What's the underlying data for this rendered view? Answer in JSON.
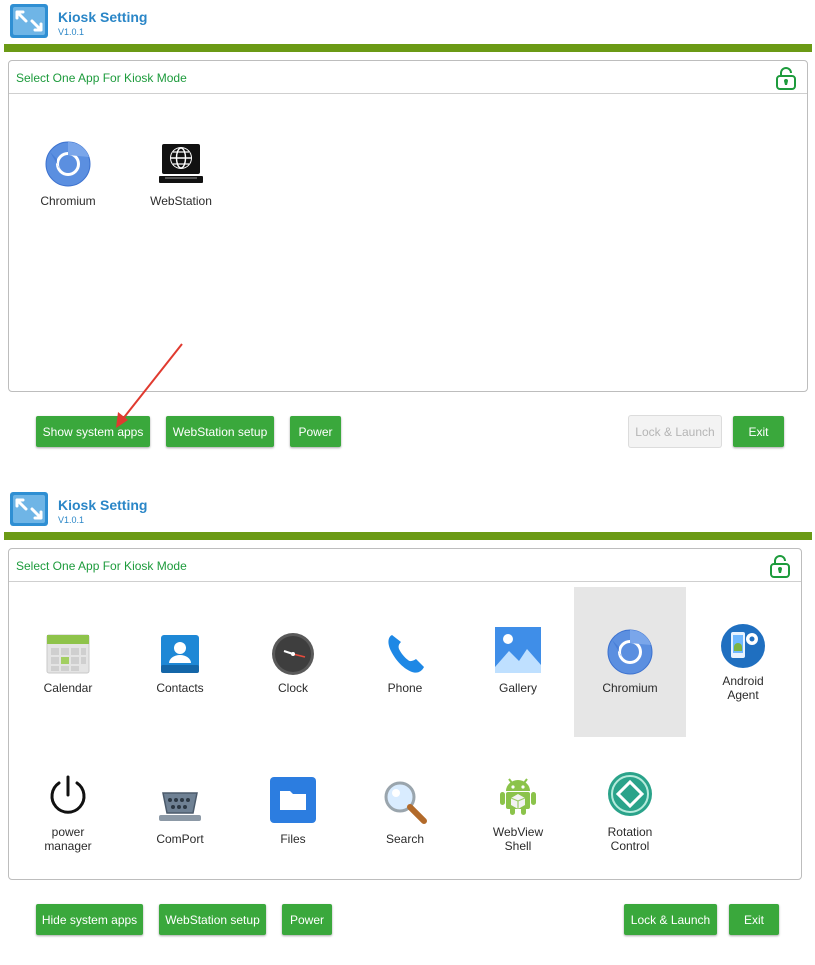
{
  "colors": {
    "brand_blue": "#2a86c7",
    "header_rule": "#6b9a15",
    "button_green": "#3aa83c",
    "title_green": "#1d9b3c",
    "annotation_red": "#e03a2f"
  },
  "screen1": {
    "header": {
      "title": "Kiosk Setting",
      "version": "V1.0.1"
    },
    "panel": {
      "title": "Select One App For Kiosk Mode",
      "apps": [
        {
          "label": "Chromium",
          "icon": "chromium-icon"
        },
        {
          "label": "WebStation",
          "icon": "globe-monitor-icon"
        }
      ]
    },
    "buttons": {
      "show_system_apps": "Show system apps",
      "webstation_setup": "WebStation setup",
      "power": "Power",
      "lock_launch": "Lock & Launch",
      "exit": "Exit"
    }
  },
  "screen2": {
    "header": {
      "title": "Kiosk Setting",
      "version": "V1.0.1"
    },
    "panel": {
      "title": "Select One App For Kiosk Mode",
      "selected_app": "Chromium",
      "apps_row1": [
        {
          "label": "Calendar",
          "icon": "calendar-icon"
        },
        {
          "label": "Contacts",
          "icon": "contacts-icon"
        },
        {
          "label": "Clock",
          "icon": "clock-icon"
        },
        {
          "label": "Phone",
          "icon": "phone-icon"
        },
        {
          "label": "Gallery",
          "icon": "gallery-icon"
        },
        {
          "label": "Chromium",
          "icon": "chromium-icon"
        },
        {
          "label_l1": "Android",
          "label_l2": "Agent",
          "icon": "android-agent-icon"
        }
      ],
      "apps_row2": [
        {
          "label_l1": "power",
          "label_l2": "manager",
          "icon": "power-icon"
        },
        {
          "label": "ComPort",
          "icon": "serial-port-icon"
        },
        {
          "label": "Files",
          "icon": "folder-icon"
        },
        {
          "label": "Search",
          "icon": "magnifier-icon"
        },
        {
          "label_l1": "WebView",
          "label_l2": "Shell",
          "icon": "android-robot-icon"
        },
        {
          "label_l1": "Rotation",
          "label_l2": "Control",
          "icon": "rotation-icon"
        }
      ]
    },
    "buttons": {
      "hide_system_apps": "Hide system apps",
      "webstation_setup": "WebStation setup",
      "power": "Power",
      "lock_launch": "Lock & Launch",
      "exit": "Exit"
    }
  }
}
